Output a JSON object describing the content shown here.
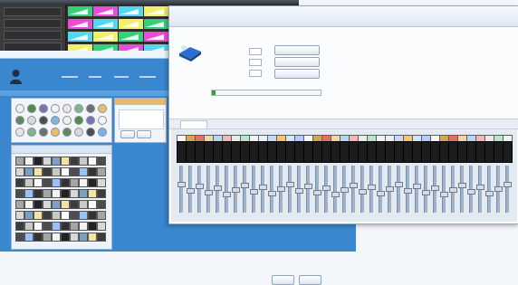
{
  "dark_window": {
    "grid": {
      "rows": 4,
      "cols": 9,
      "palette": [
        "#34d07a",
        "#e84dd6",
        "#54d7f2",
        "#f2ef6a"
      ]
    }
  },
  "blue_window": {
    "colors": {
      "background": "#3a86cf",
      "strip": "#5aa0e0"
    },
    "effect_swatches": [
      "#f0f0f0",
      "#4e8f4b",
      "#7f6fb3",
      "#f5f5f5",
      "#e7e7e7",
      "#7fb68a",
      "#6e6f72",
      "#e7c06a",
      "#5f8a62",
      "#d9d9d9",
      "#4e4e4e",
      "#79b4e9"
    ],
    "gobo_swatches": [
      "#a5a5a5",
      "#f2f2f2",
      "#222222",
      "#d8d8d8",
      "#7aa0c4",
      "#f4e3a3",
      "#3c3c3c",
      "#c9c9c9",
      "#ffffff",
      "#4c4c4c",
      "#9cc0ff",
      "#333333"
    ]
  },
  "mixer_window": {
    "progress_fraction": 0.03,
    "strip_cap_colors": [
      "#f7f7f7",
      "#d9a54a",
      "#e56f5f",
      "#f2d7a5",
      "#b2d8f5",
      "#f3b5b5",
      "#eaeaea",
      "#b7e6c6",
      "#f1f1f1",
      "#e9f1fb",
      "#c8d9f8",
      "#f7c36b",
      "#d0e6ff",
      "#b1cbff"
    ]
  }
}
